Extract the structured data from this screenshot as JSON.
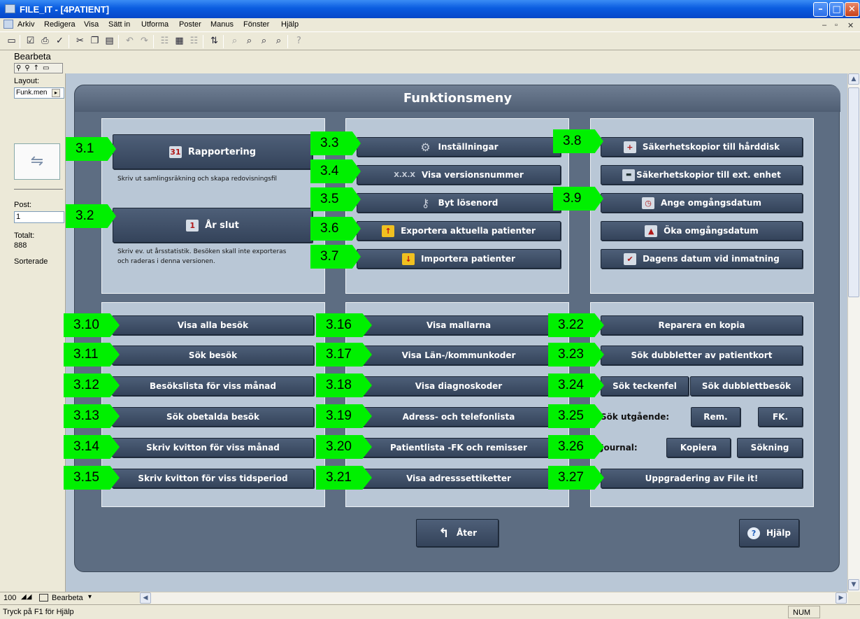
{
  "window": {
    "title": "FILE_IT - [4PATIENT]"
  },
  "menu": {
    "items": [
      "Arkiv",
      "Redigera",
      "Visa",
      "Sätt in",
      "Utforma",
      "Poster",
      "Manus",
      "Fönster",
      "Hjälp"
    ]
  },
  "sidebar": {
    "mode_label": "Bearbeta",
    "layout_label": "Layout:",
    "layout_value": "Funk.men",
    "post_label": "Post:",
    "post_value": "1",
    "total_label": "Totalt:",
    "total_value": "888",
    "sorted_label": "Sorterade"
  },
  "panel": {
    "title": "Funktionsmeny"
  },
  "top_buttons": {
    "rapportering": "Rapportering",
    "ar_slut": "År slut",
    "installningar": "Inställningar",
    "visa_version": "Visa versionsnummer",
    "version_icon_text": "X.X.X",
    "byt_losenord": "Byt lösenord",
    "exportera": "Exportera aktuella patienter",
    "importera": "Importera patienter",
    "sak_hard": "Säkerhetskopior till hårddisk",
    "sak_ext": "Säkerhetskopior till ext. enhet",
    "ange_datum": "Ange omgångsdatum",
    "oka_datum": "Öka omgångsdatum",
    "dagens_datum": "Dagens datum vid inmatning"
  },
  "descriptions": {
    "rapportering": "Skriv ut samlingsräkning och skapa redovisningsfil",
    "ar_slut_1": "Skriv ev. ut årsstatistik. Besöken skall inte exporteras",
    "ar_slut_2": "och raderas i denna versionen."
  },
  "bottom_buttons": {
    "visa_alla": "Visa alla besök",
    "sok_besok": "Sök besök",
    "besokslista": "Besökslista för viss månad",
    "obetalda": "Sök obetalda besök",
    "kvitton_manad": "Skriv kvitton för viss månad",
    "kvitton_tid": "Skriv kvitton för viss tidsperiod",
    "mallarna": "Visa mallarna",
    "lan": "Visa Län-/kommunkoder",
    "diagnos": "Visa diagnoskoder",
    "adress": "Adress- och telefonlista",
    "patientlista": "Patientlista -FK och remisser",
    "etiketter": "Visa adresssettiketter",
    "reparera": "Reparera en kopia",
    "dubbletter": "Sök dubbletter av patientkort",
    "teckenfel": "Sök teckenfel",
    "dubblettbesok": "Sök dubblettbesök",
    "sok_utgaende": "Sök utgående:",
    "rem": "Rem.",
    "fk": "FK.",
    "journal": "Journal:",
    "kopiera": "Kopiera",
    "sokning": "Sökning",
    "uppgradering": "Uppgradering av File it!"
  },
  "footer": {
    "ater": "Åter",
    "hjalp": "Hjälp"
  },
  "annotations": [
    "3.1",
    "3.2",
    "3.3",
    "3.4",
    "3.5",
    "3.6",
    "3.7",
    "3.8",
    "3.9",
    "3.10",
    "3.11",
    "3.12",
    "3.13",
    "3.14",
    "3.15",
    "3.16",
    "3.17",
    "3.18",
    "3.19",
    "3.20",
    "3.21",
    "3.22",
    "3.23",
    "3.24",
    "3.25",
    "3.26",
    "3.27"
  ],
  "bottom_bar": {
    "zoom": "100",
    "mode": "Bearbeta"
  },
  "status": {
    "text": "Tryck på F1 för Hjälp",
    "num": "NUM"
  }
}
